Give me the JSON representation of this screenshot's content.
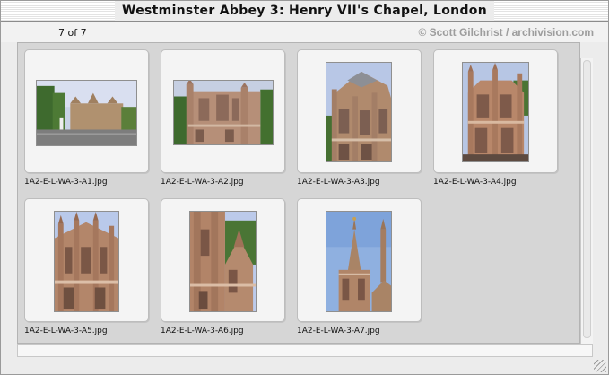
{
  "window": {
    "title": "Westminster Abbey 3: Henry VII's Chapel, London"
  },
  "info": {
    "count": "7 of 7",
    "credit": "© Scott Gilchrist / archivision.com"
  },
  "thumbnails": [
    {
      "filename": "1A2-E-L-WA-3-A1.jpg"
    },
    {
      "filename": "1A2-E-L-WA-3-A2.jpg"
    },
    {
      "filename": "1A2-E-L-WA-3-A3.jpg"
    },
    {
      "filename": "1A2-E-L-WA-3-A4.jpg"
    },
    {
      "filename": "1A2-E-L-WA-3-A5.jpg"
    },
    {
      "filename": "1A2-E-L-WA-3-A6.jpg"
    },
    {
      "filename": "1A2-E-L-WA-3-A7.jpg"
    }
  ],
  "colors": {
    "sky": "#b9c9e8",
    "stone": "#b58a6c",
    "tree": "#3d6b2e"
  }
}
